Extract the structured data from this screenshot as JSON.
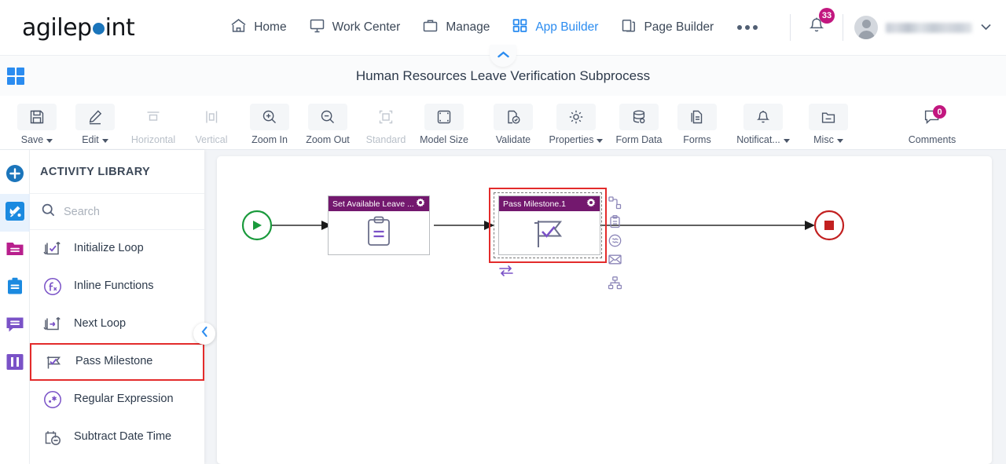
{
  "brand": {
    "name_part1": "agilep",
    "name_part2": "int",
    "accent": "#1b75bb"
  },
  "topnav": {
    "items": [
      {
        "label": "Home",
        "icon": "home-icon",
        "active": false
      },
      {
        "label": "Work Center",
        "icon": "monitor-icon",
        "active": false
      },
      {
        "label": "Manage",
        "icon": "briefcase-icon",
        "active": false
      },
      {
        "label": "App Builder",
        "icon": "grid-icon",
        "active": true
      },
      {
        "label": "Page Builder",
        "icon": "pages-icon",
        "active": false
      }
    ],
    "more_label": "...",
    "notifications": {
      "count": "33",
      "icon": "bell-icon",
      "badge_color": "#c2177f"
    },
    "user": {
      "name": "",
      "icon": "avatar"
    }
  },
  "subheader": {
    "title": "Human Resources Leave Verification Subprocess",
    "apps_icon": "app-grid-icon",
    "collapse_icon": "chevron-up-icon"
  },
  "toolbar": {
    "buttons": [
      {
        "label": "Save",
        "icon": "save-icon",
        "dropdown": true,
        "disabled": false
      },
      {
        "label": "Edit",
        "icon": "pencil-icon",
        "dropdown": true,
        "disabled": false
      },
      {
        "label": "Horizontal",
        "icon": "align-horizontal-icon",
        "dropdown": false,
        "disabled": true
      },
      {
        "label": "Vertical",
        "icon": "align-vertical-icon",
        "dropdown": false,
        "disabled": true
      },
      {
        "label": "Zoom In",
        "icon": "zoom-in-icon",
        "dropdown": false,
        "disabled": false
      },
      {
        "label": "Zoom Out",
        "icon": "zoom-out-icon",
        "dropdown": false,
        "disabled": false
      },
      {
        "label": "Standard",
        "icon": "standard-size-icon",
        "dropdown": false,
        "disabled": true
      },
      {
        "label": "Model Size",
        "icon": "model-size-icon",
        "dropdown": false,
        "disabled": false
      },
      {
        "label": "Validate",
        "icon": "validate-icon",
        "dropdown": false,
        "disabled": false
      },
      {
        "label": "Properties",
        "icon": "gear-icon",
        "dropdown": true,
        "disabled": false
      },
      {
        "label": "Form Data",
        "icon": "database-icon",
        "dropdown": false,
        "disabled": false
      },
      {
        "label": "Forms",
        "icon": "form-icon",
        "dropdown": false,
        "disabled": false
      },
      {
        "label": "Notificat...",
        "icon": "bell-icon",
        "dropdown": true,
        "disabled": false
      },
      {
        "label": "Misc",
        "icon": "folder-icon",
        "dropdown": true,
        "disabled": false
      }
    ],
    "comments": {
      "label": "Comments",
      "icon": "comment-icon",
      "count": "0",
      "badge_color": "#c2177f"
    }
  },
  "rail": {
    "items": [
      {
        "name": "add-icon",
        "color": "#1b75bb",
        "active": false
      },
      {
        "name": "activities-icon",
        "color": "#1b8ae0",
        "active": true
      },
      {
        "name": "folder-icon",
        "color": "#b81f8d",
        "active": false
      },
      {
        "name": "clipboard-icon",
        "color": "#1b8ae0",
        "active": false
      },
      {
        "name": "comment-icon",
        "color": "#7a52c7",
        "active": false
      },
      {
        "name": "swimlane-icon",
        "color": "#7a52c7",
        "active": false
      }
    ]
  },
  "sidebar": {
    "title": "ACTIVITY LIBRARY",
    "search": {
      "placeholder": "Search",
      "value": "",
      "icon": "search-icon"
    },
    "collapse_icon": "chevron-left-icon",
    "activities": [
      {
        "label": "Initialize Loop",
        "icon": "initialize-loop-icon",
        "selected": false
      },
      {
        "label": "Inline Functions",
        "icon": "inline-functions-icon",
        "selected": false
      },
      {
        "label": "Next Loop",
        "icon": "next-loop-icon",
        "selected": false
      },
      {
        "label": "Pass Milestone",
        "icon": "pass-milestone-icon",
        "selected": true
      },
      {
        "label": "Regular Expression",
        "icon": "regular-expression-icon",
        "selected": false
      },
      {
        "label": "Subtract Date Time",
        "icon": "subtract-date-time-icon",
        "selected": false
      }
    ]
  },
  "canvas": {
    "start_node": {
      "name": "start-event",
      "color": "#1a9a3c"
    },
    "end_node": {
      "name": "end-event",
      "color": "#c22020"
    },
    "nodes": [
      {
        "title": "Set Available Leave ...",
        "icon": "clipboard-task-icon",
        "selected": false,
        "gear": "gear-icon"
      },
      {
        "title": "Pass Milestone.1",
        "icon": "pass-milestone-flag-icon",
        "selected": true,
        "gear": "gear-icon"
      }
    ],
    "swap_icon": "swap-arrows-icon",
    "palette": [
      {
        "name": "connector-icon"
      },
      {
        "name": "task-icon"
      },
      {
        "name": "event-icon"
      },
      {
        "name": "message-icon"
      },
      {
        "name": "subprocess-icon"
      }
    ]
  }
}
